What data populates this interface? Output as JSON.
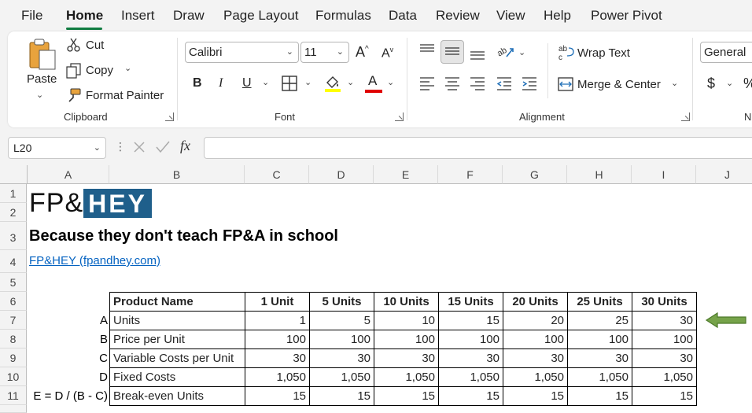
{
  "menu": {
    "items": [
      "File",
      "Home",
      "Insert",
      "Draw",
      "Page Layout",
      "Formulas",
      "Data",
      "Review",
      "View",
      "Help",
      "Power Pivot"
    ]
  },
  "ribbon": {
    "clipboard": {
      "paste": "Paste",
      "cut": "Cut",
      "copy": "Copy",
      "format_painter": "Format Painter",
      "label": "Clipboard"
    },
    "font": {
      "name": "Calibri",
      "size": "11",
      "label": "Font",
      "bold": "B",
      "italic": "I",
      "underline": "U",
      "increase": "A",
      "decrease": "A",
      "font_color_letter": "A"
    },
    "alignment": {
      "wrap_text": "Wrap Text",
      "merge_center": "Merge & Center",
      "label": "Alignment"
    },
    "number": {
      "format": "General",
      "currency": "$",
      "percent": "%",
      "label": "N"
    }
  },
  "formula_bar": {
    "name_box": "L20",
    "fx": "fx",
    "formula": ""
  },
  "columns": [
    "A",
    "B",
    "C",
    "D",
    "E",
    "F",
    "G",
    "H",
    "I",
    "J"
  ],
  "rows": [
    "1",
    "2",
    "3",
    "4",
    "5",
    "6",
    "7",
    "8",
    "9",
    "10",
    "11"
  ],
  "sheet": {
    "logo_left": "FP&",
    "logo_right": "HEY",
    "subtitle": "Because they don't teach FP&A in school",
    "link": "FP&HEY (fpandhey.com)",
    "row_labels": [
      "A",
      "B",
      "C",
      "D",
      "E = D / (B - C)"
    ],
    "table": {
      "headers": [
        "Product Name",
        "1 Unit",
        "5 Units",
        "10 Units",
        "15 Units",
        "20 Units",
        "25 Units",
        "30 Units"
      ],
      "rows": [
        [
          "Units",
          "1",
          "5",
          "10",
          "15",
          "20",
          "25",
          "30"
        ],
        [
          "Price per Unit",
          "100",
          "100",
          "100",
          "100",
          "100",
          "100",
          "100"
        ],
        [
          "Variable Costs per Unit",
          "30",
          "30",
          "30",
          "30",
          "30",
          "30",
          "30"
        ],
        [
          "Fixed Costs",
          "1,050",
          "1,050",
          "1,050",
          "1,050",
          "1,050",
          "1,050",
          "1,050"
        ],
        [
          "Break-even Units",
          "15",
          "15",
          "15",
          "15",
          "15",
          "15",
          "15"
        ]
      ]
    }
  },
  "colors": {
    "accent_green": "#107c41",
    "logo_blue": "#1f5f8b",
    "arrow_fill": "#76a34a",
    "link": "#0563c1"
  }
}
